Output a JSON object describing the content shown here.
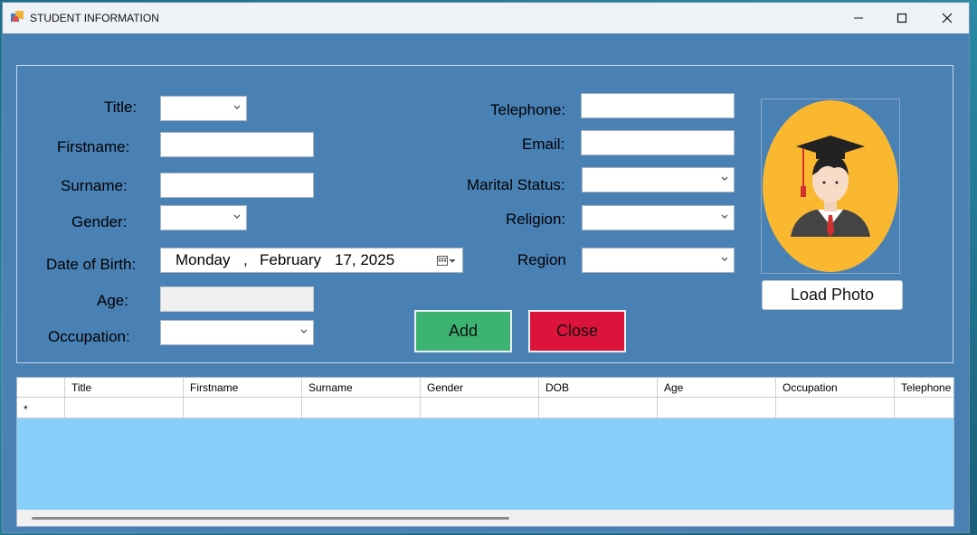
{
  "window": {
    "title": "STUDENT INFORMATION"
  },
  "labels": {
    "title": "Title:",
    "firstname": "Firstname:",
    "surname": "Surname:",
    "gender": "Gender:",
    "dob": "Date of Birth:",
    "age": "Age:",
    "occupation": "Occupation:",
    "telephone": "Telephone:",
    "email": "Email:",
    "marital": "Marital Status:",
    "religion": "Religion:",
    "region": "Region"
  },
  "dob": {
    "day": "Monday",
    "comma": ",",
    "month": "February",
    "date": "17, 2025"
  },
  "buttons": {
    "load_photo": "Load Photo",
    "add": "Add",
    "close": "Close"
  },
  "grid": {
    "columns": [
      "Title",
      "Firstname",
      "Surname",
      "Gender",
      "DOB",
      "Age",
      "Occupation",
      "Telephone"
    ],
    "new_row_marker": "*"
  },
  "colors": {
    "form_bg": "#4a81b5",
    "grid_bg": "#87cefa",
    "add": "#3cb371",
    "close": "#dc143c",
    "photo_bg": "#f9b830"
  },
  "icons": {
    "photo": "graduate-avatar-icon",
    "calendar": "calendar-icon",
    "dropdown": "chevron-down-icon"
  }
}
